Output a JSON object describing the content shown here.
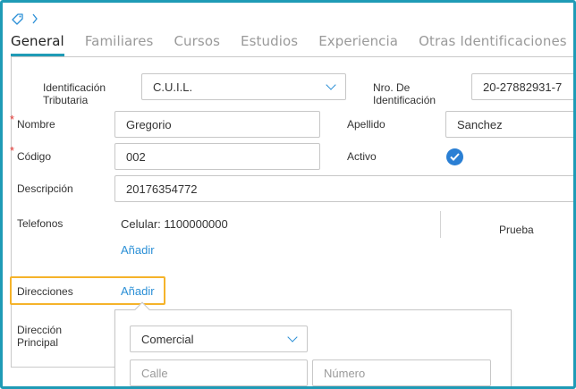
{
  "breadcrumb": {
    "tag_icon": "tag-icon",
    "separator_icon": "chevron-right-icon"
  },
  "tabs": [
    {
      "label": "General",
      "active": true
    },
    {
      "label": "Familiares",
      "active": false
    },
    {
      "label": "Cursos",
      "active": false
    },
    {
      "label": "Estudios",
      "active": false
    },
    {
      "label": "Experiencia",
      "active": false
    },
    {
      "label": "Otras Identificaciones",
      "active": false
    }
  ],
  "form": {
    "id_tributaria": {
      "label_line1": "Identificación",
      "label_line2": "Tributaria",
      "value": "C.U.I.L."
    },
    "nro_id": {
      "label_line1": "Nro. De",
      "label_line2": "Identificación",
      "value": "20-27882931-7"
    },
    "nombre": {
      "required_mark": "*",
      "label": "Nombre",
      "value": "Gregorio"
    },
    "apellido": {
      "label": "Apellido",
      "value": "Sanchez"
    },
    "codigo": {
      "required_mark": "*",
      "label": "Código",
      "value": "002"
    },
    "activo": {
      "label": "Activo",
      "checked": true
    },
    "descripcion": {
      "label": "Descripción",
      "value": "20176354772"
    },
    "telefonos": {
      "label": "Telefonos",
      "entry": "Celular: 1100000000",
      "add_label": "Añadir",
      "note": "Prueba"
    },
    "direcciones": {
      "label": "Direcciones",
      "add_label": "Añadir"
    },
    "direccion_principal": {
      "label_line1": "Dirección",
      "label_line2": "Principal"
    }
  },
  "popup": {
    "type_value": "Comercial",
    "calle_placeholder": "Calle",
    "numero_placeholder": "Número"
  },
  "colors": {
    "accent": "#1f9bb6",
    "link": "#2a8fd6",
    "highlight": "#f5b32a",
    "required": "#e53935"
  }
}
